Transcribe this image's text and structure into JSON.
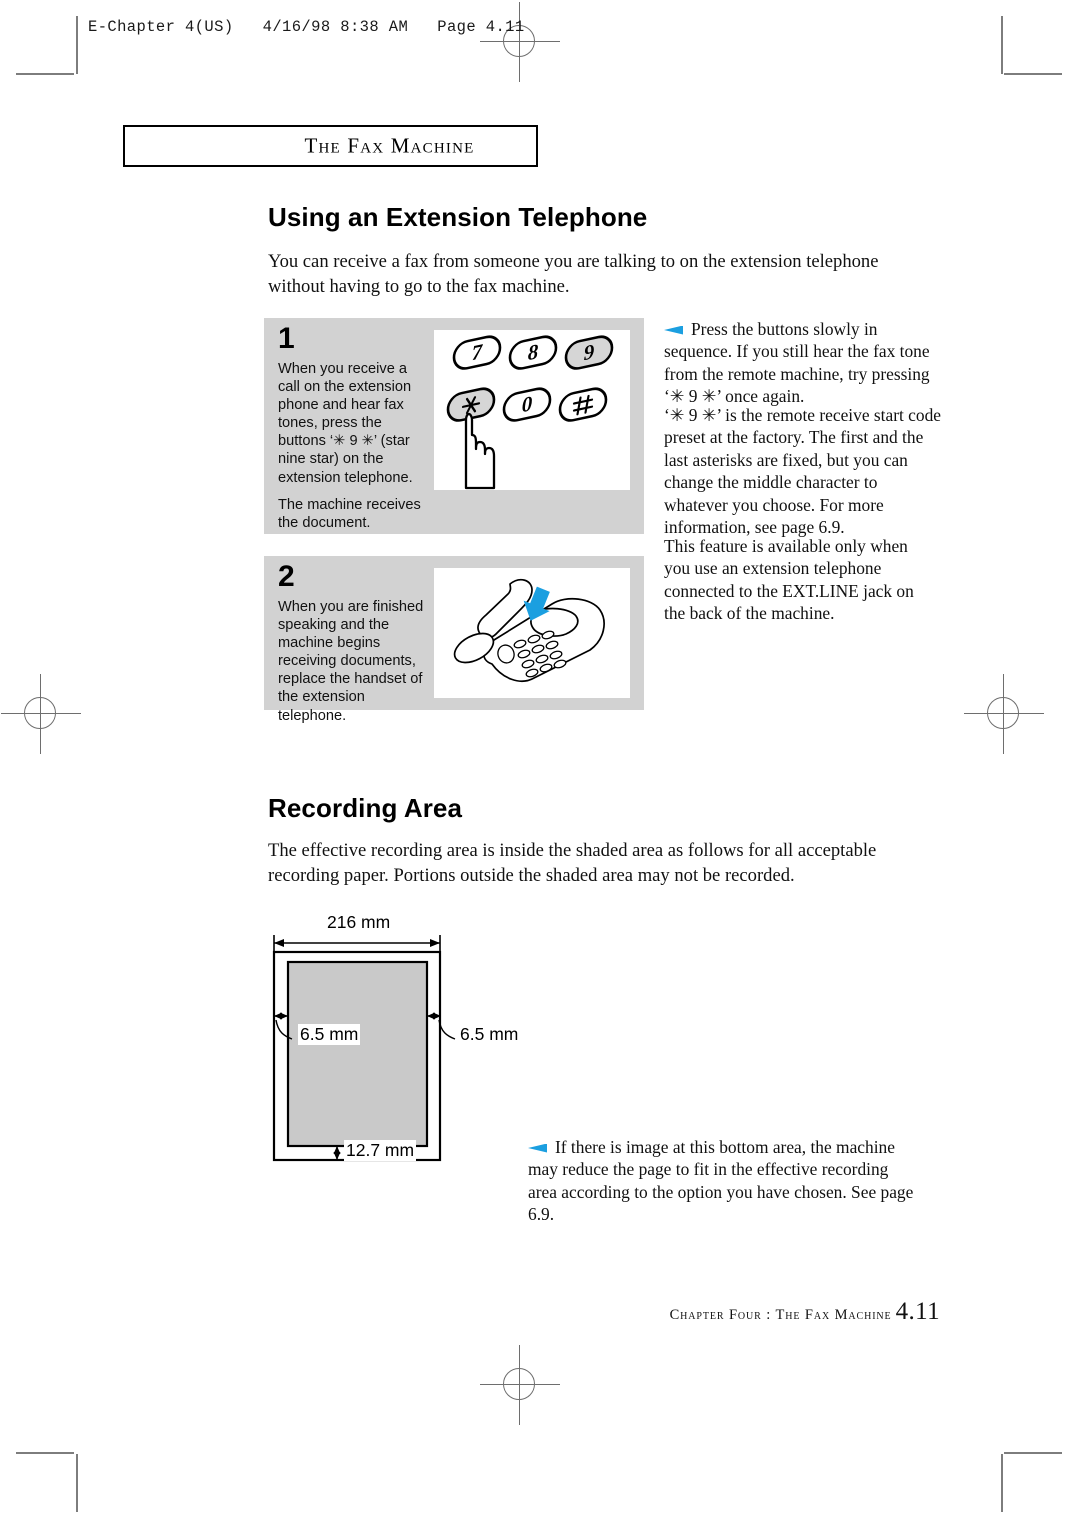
{
  "slug": "E-Chapter 4(US)   4/16/98 8:38 AM   Page 4.11",
  "running_head": "The Fax Machine",
  "sections": {
    "extension": {
      "heading": "Using an Extension Telephone",
      "intro": "You  can receive a fax from someone you are talking to on the extension telephone without having to go to the fax machine.",
      "steps": [
        {
          "number": "1",
          "text": "When you receive a call on the extension phone and hear fax tones, press the buttons ‘✳ 9 ✳’ (star nine star) on the extension telephone.",
          "extra": "The machine receives the document.",
          "illustration": "keypad-with-pointing-finger",
          "keypad_keys": [
            "7",
            "8",
            "9",
            "✳",
            "0",
            "#"
          ],
          "keypad_highlighted": [
            "9",
            "✳"
          ]
        },
        {
          "number": "2",
          "text": "When you are finished speaking and the machine begins receiving documents, replace the handset of the extension telephone.",
          "extra": "",
          "illustration": "telephone-replace-handset",
          "keypad_keys": [],
          "keypad_highlighted": []
        }
      ],
      "notes": [
        "Press the buttons slowly in sequence. If you still hear the fax tone from the remote machine, try pressing ‘✳ 9 ✳’ once again.",
        "‘✳ 9 ✳’ is the remote receive start code preset at the factory. The first and the last asterisks are fixed, but you can change the middle character to whatever you choose. For more information, see page 6.9.",
        "This feature is available only when you use an extension telephone connected to the EXT.LINE jack on the back of the machine."
      ]
    },
    "recording": {
      "heading": "Recording Area",
      "intro": "The effective recording area is inside the shaded area as follows for all acceptable recording paper. Portions outside the shaded area may not be recorded.",
      "diagram": {
        "width_label": "216 mm",
        "left_margin_label": "6.5 mm",
        "right_margin_label": "6.5 mm",
        "bottom_margin_label": "12.7 mm"
      },
      "note": "If there is image at this bottom area, the machine may reduce the page to fit in the effective recording area according to the option you have chosen. See page 6.9."
    }
  },
  "footer": {
    "caption": "Chapter Four : The Fax Machine",
    "page": "4.11"
  },
  "colors": {
    "step_box_bg": "#d2d2d2",
    "art_bg": "#ffffff",
    "bullet_blue": "#1b9fe0",
    "shade_gray": "#c9c9c9",
    "crop_gray": "#7d7d7d"
  }
}
